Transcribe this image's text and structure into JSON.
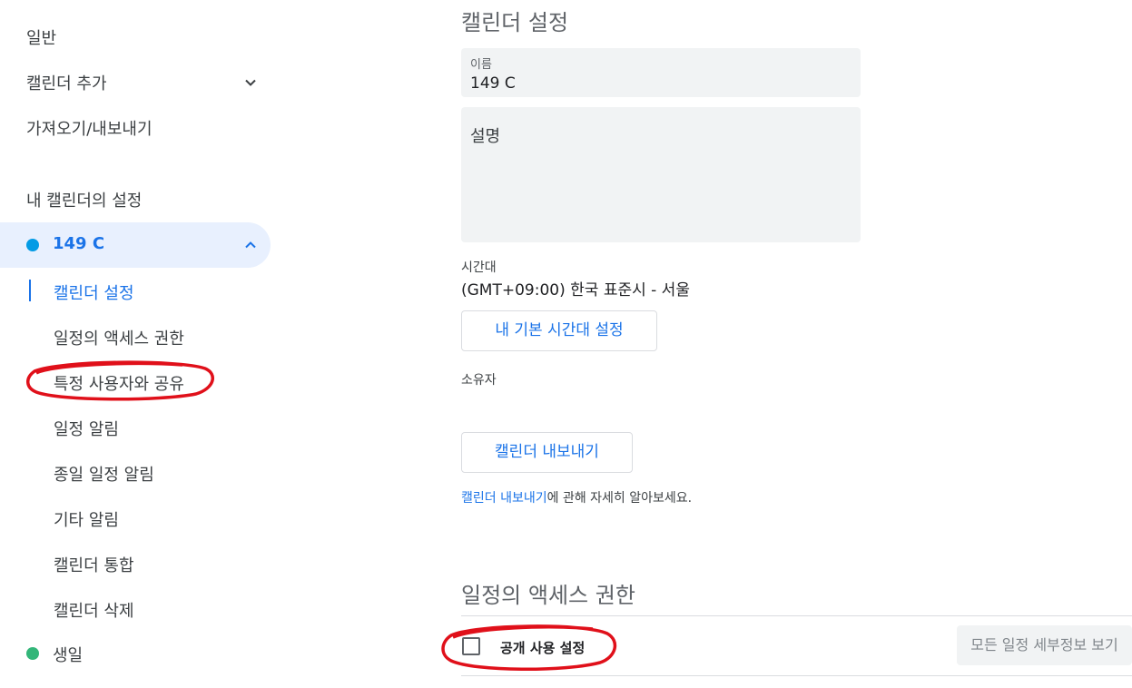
{
  "sidebar": {
    "general": "일반",
    "add_calendar": "캘린더 추가",
    "import_export": "가져오기/내보내기",
    "my_calendars_heading": "내 캘린더의 설정",
    "calendar": {
      "name": "149 C",
      "color": "#039be5"
    },
    "sub_items": [
      {
        "label": "캘린더 설정",
        "active": true
      },
      {
        "label": "일정의 액세스 권한"
      },
      {
        "label": "특정 사용자와 공유"
      },
      {
        "label": "일정 알림"
      },
      {
        "label": "종일 일정 알림"
      },
      {
        "label": "기타 알림"
      },
      {
        "label": "캘린더 통합"
      },
      {
        "label": "캘린더 삭제"
      }
    ],
    "birthday": {
      "name": "생일",
      "color": "#33b679"
    }
  },
  "main": {
    "settings_title": "캘린더 설정",
    "name_field": {
      "label": "이름",
      "value": "149 C"
    },
    "description_field": {
      "placeholder": "설명"
    },
    "timezone": {
      "label": "시간대",
      "value": "(GMT+09:00) 한국 표준시 - 서울"
    },
    "set_default_tz_button": "내 기본 시간대 설정",
    "owner_label": "소유자",
    "export_button": "캘린더 내보내기",
    "help": {
      "link": "캘린더 내보내기",
      "text": "에 관해 자세히 알아보세요."
    },
    "access_title": "일정의 액세스 권한",
    "public_checkbox_label": "공개 사용 설정",
    "view_all_details_button": "모든 일정 세부정보 보기"
  },
  "colors": {
    "accent": "#1a73e8",
    "annotation": "#e0101a"
  }
}
